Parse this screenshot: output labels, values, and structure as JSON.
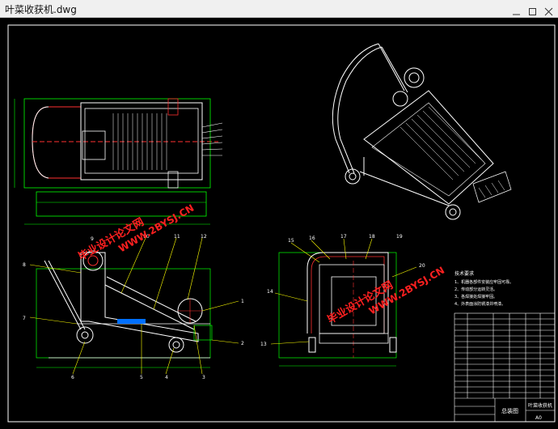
{
  "window": {
    "title": "叶菜收获机.dwg"
  },
  "watermark": {
    "text": "毕业设计论文网",
    "url": "WWW.2BYSJ.CN"
  },
  "side_view": {
    "part_numbers": [
      "1",
      "2",
      "3",
      "4",
      "5",
      "6",
      "7",
      "8",
      "9",
      "10",
      "11",
      "12"
    ]
  },
  "front_view": {
    "part_numbers": [
      "13",
      "14",
      "15",
      "16",
      "17",
      "18",
      "19",
      "20"
    ]
  },
  "tech_notes": {
    "title": "技术要求",
    "lines": [
      "1、机器各部件安装应牢固可靠。",
      "2、传动部分运转灵活。",
      "3、各焊接处焊接牢固。",
      "4、外表面涂防锈漆并喷漆。"
    ]
  },
  "title_block": {
    "drawing_name": "总装图",
    "machine_name": "叶菜收获机",
    "sheet_size": "A0"
  },
  "colors": {
    "outline": "#ffffff",
    "dimension": "#00ff00",
    "center": "#ff3030",
    "leader": "#ffff00",
    "watermark": "#ff2020"
  }
}
